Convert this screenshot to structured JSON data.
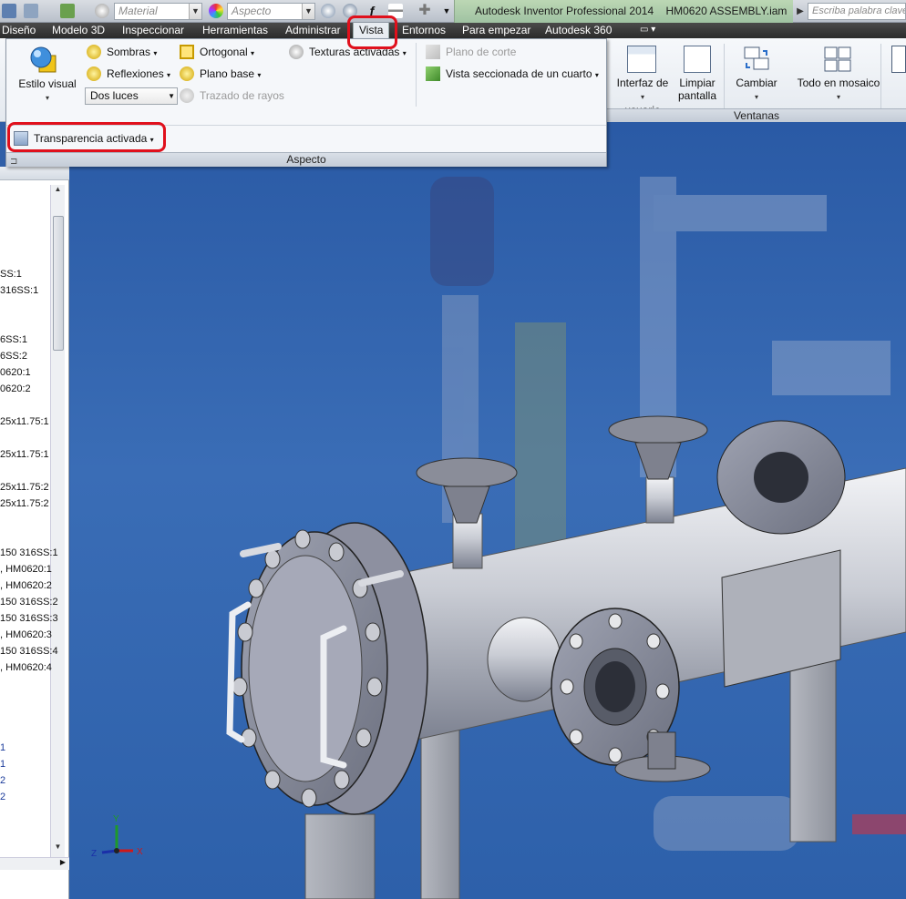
{
  "quick_access": {
    "material_placeholder": "Material",
    "appearance_placeholder": "Aspecto",
    "app_title": "Autodesk Inventor Professional 2014",
    "document_title": "HM0620 ASSEMBLY.iam",
    "help_search_placeholder": "Escriba palabra clave o frase"
  },
  "tabs": [
    {
      "label": "Diseño"
    },
    {
      "label": "Modelo 3D"
    },
    {
      "label": "Inspeccionar"
    },
    {
      "label": "Herramientas"
    },
    {
      "label": "Administrar"
    },
    {
      "label": "Vista",
      "active": true
    },
    {
      "label": "Entornos"
    },
    {
      "label": "Para empezar"
    },
    {
      "label": "Autodesk 360"
    }
  ],
  "ribbon": {
    "visual_style_label": "Estilo visual",
    "shadows_label": "Sombras",
    "reflections_label": "Reflexiones",
    "lighting_select": "Dos luces",
    "orthographic_label": "Ortogonal",
    "ground_plane_label": "Plano base",
    "ray_tracing_label": "Trazado de rayos",
    "textures_label": "Texturas activadas",
    "section_plane_label": "Plano de corte",
    "quarter_section_label": "Vista seccionada de un cuarto",
    "transparency_label": "Transparencia activada",
    "aspect_panel_title": "Aspecto",
    "user_interface_label_1": "Interfaz de",
    "user_interface_label_2": "usuario",
    "clean_screen_label_1": "Limpiar",
    "clean_screen_label_2": "pantalla",
    "switch_label": "Cambiar",
    "tile_all_label": "Todo en mosaico",
    "windows_panel_title": "Ventanas"
  },
  "browser": {
    "lines": [
      "SS:1",
      "316SS:1",
      "6SS:1",
      "6SS:2",
      "0620:1",
      "0620:2",
      "25x11.75:1",
      "25x11.75:1",
      "25x11.75:2",
      "25x11.75:2",
      "150 316SS:1",
      ", HM0620:1",
      ", HM0620:2",
      "150 316SS:2",
      "150 316SS:3",
      ", HM0620:3",
      "150 316SS:4",
      ", HM0620:4",
      "1",
      "1",
      "2",
      "2"
    ]
  },
  "axis": {
    "x": "X",
    "y": "Y",
    "z": "Z"
  },
  "colors": {
    "highlight": "#e0101c",
    "viewport_bg": "#2f5fa8",
    "tab_bar": "#2b2b2b"
  }
}
